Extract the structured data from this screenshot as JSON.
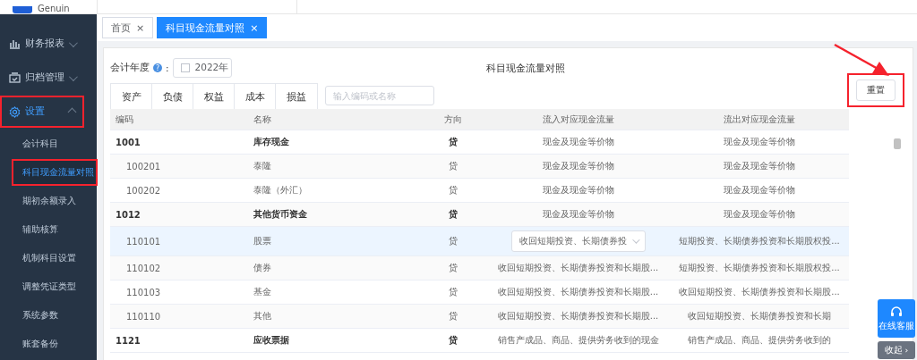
{
  "logo": {
    "text": "Genuin"
  },
  "sidebar": {
    "items": [
      {
        "label": "财务报表",
        "kind": "chart",
        "expanded": false,
        "highlighted": false,
        "selected": false
      },
      {
        "label": "归档管理",
        "kind": "archive",
        "expanded": false,
        "highlighted": false,
        "selected": false
      },
      {
        "label": "设置",
        "kind": "gear",
        "expanded": true,
        "highlighted": true,
        "selected": true,
        "children": [
          {
            "label": "会计科目",
            "selected": false,
            "highlighted": false
          },
          {
            "label": "科目现金流量对照",
            "selected": true,
            "highlighted": true
          },
          {
            "label": "期初余额录入",
            "selected": false,
            "highlighted": false
          },
          {
            "label": "辅助核算",
            "selected": false,
            "highlighted": false
          },
          {
            "label": "机制科目设置",
            "selected": false,
            "highlighted": false
          },
          {
            "label": "调整凭证类型",
            "selected": false,
            "highlighted": false
          },
          {
            "label": "系统参数",
            "selected": false,
            "highlighted": false
          },
          {
            "label": "账套备份",
            "selected": false,
            "highlighted": false
          }
        ]
      }
    ]
  },
  "page_tabs": [
    {
      "label": "首页",
      "close": "×",
      "selected": false
    },
    {
      "label": "科目现金流量对照",
      "close": "×",
      "selected": true
    }
  ],
  "toolbar": {
    "year_label": "会计年度",
    "help_icon": "?",
    "year_sep": ":",
    "year_value": "2022年",
    "title": "科目现金流量对照",
    "filters": [
      {
        "label": "资产",
        "selected": false
      },
      {
        "label": "负债",
        "selected": false
      },
      {
        "label": "权益",
        "selected": false
      },
      {
        "label": "成本",
        "selected": false
      },
      {
        "label": "损益",
        "selected": false
      }
    ],
    "search": {
      "placeholder": "输入编码或名称"
    },
    "reset": {
      "label": "重置",
      "highlighted": true
    }
  },
  "table": {
    "columns": [
      "编码",
      "名称",
      "方向",
      "流入对应现金流量",
      "流出对应现金流量"
    ],
    "rows": [
      {
        "code": "1001",
        "name": "库存现金",
        "direction": "贷",
        "inflow": "现金及现金等价物",
        "outflow": "现金及现金等价物",
        "kind": "parent",
        "selected": false
      },
      {
        "code": "100201",
        "name": "泰隆",
        "direction": "贷",
        "inflow": "现金及现金等价物",
        "outflow": "现金及现金等价物",
        "kind": "child",
        "selected": false
      },
      {
        "code": "100202",
        "name": "泰隆（外汇）",
        "direction": "贷",
        "inflow": "现金及现金等价物",
        "outflow": "现金及现金等价物",
        "kind": "child",
        "selected": false
      },
      {
        "code": "1012",
        "name": "其他货币资金",
        "direction": "贷",
        "inflow": "现金及现金等价物",
        "outflow": "现金及现金等价物",
        "kind": "parent",
        "selected": false
      },
      {
        "code": "110101",
        "name": "股票",
        "direction": "贷",
        "inflow": "收回短期投资、长期债券投",
        "outflow": "短期投资、长期债券投资和长期股权投...",
        "kind": "child",
        "selected": true
      },
      {
        "code": "110102",
        "name": "债券",
        "direction": "贷",
        "inflow": "收回短期投资、长期债券投资和长期股...",
        "outflow": "短期投资、长期债券投资和长期股权投...",
        "kind": "child",
        "selected": false
      },
      {
        "code": "110103",
        "name": "基金",
        "direction": "贷",
        "inflow": "收回短期投资、长期债券投资和长期股...",
        "outflow": "收回短期投资、长期债券投资和长期股...",
        "kind": "child",
        "selected": false
      },
      {
        "code": "110110",
        "name": "其他",
        "direction": "贷",
        "inflow": "收回短期投资、长期债券投资和长期股...",
        "outflow": "收回短期投资、长期债券投资和长期",
        "kind": "child",
        "selected": false
      },
      {
        "code": "1121",
        "name": "应收票据",
        "direction": "贷",
        "inflow": "销售产成品、商品、提供劳务收到的现金",
        "outflow": "销售产成品、商品、提供劳务收到的",
        "kind": "parent",
        "selected": false
      }
    ]
  },
  "support": {
    "label": "在线客服",
    "collapse": "收起",
    "collapse_arrow": "›"
  }
}
